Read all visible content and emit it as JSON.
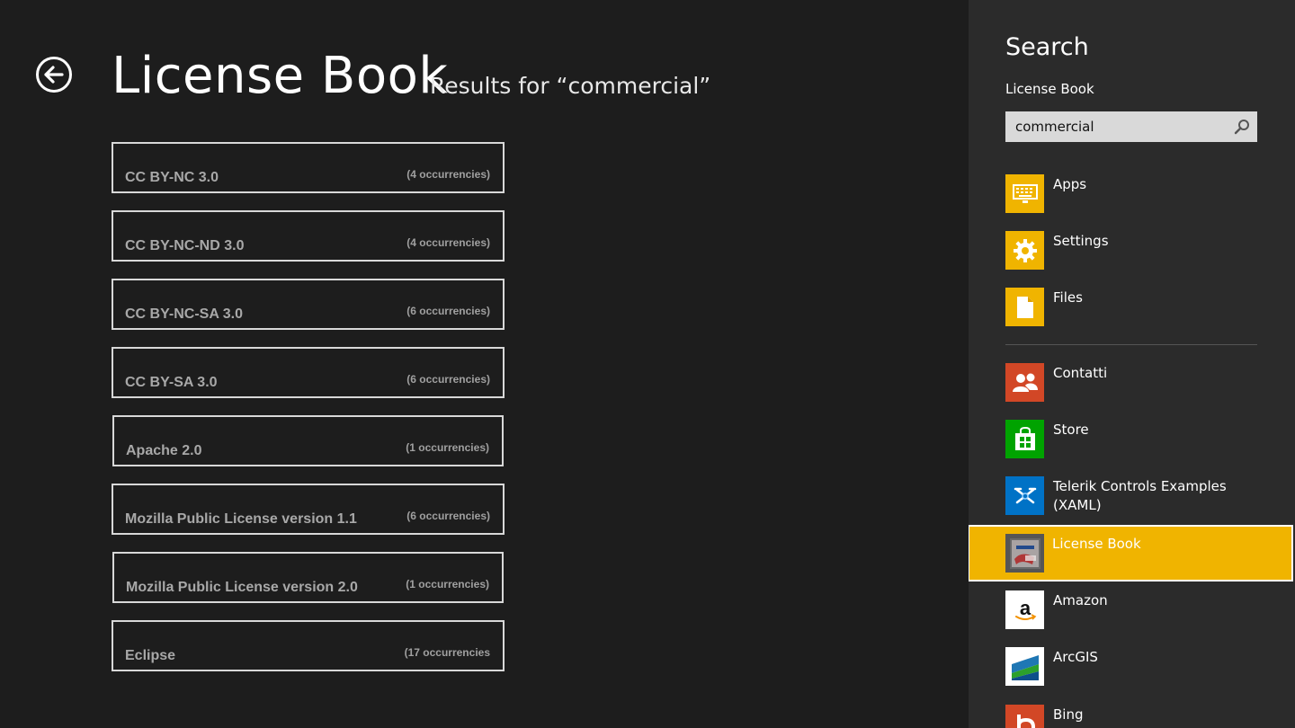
{
  "header": {
    "title": "License Book",
    "results_heading": "Results for “commercial”",
    "back_icon": "back-arrow-icon"
  },
  "results": [
    {
      "name": "CC BY-NC 3.0",
      "count": "(4 occurrencies)"
    },
    {
      "name": "CC BY-NC-ND 3.0",
      "count": "(4 occurrencies)"
    },
    {
      "name": "CC BY-NC-SA 3.0",
      "count": "(6 occurrencies)"
    },
    {
      "name": "CC BY-SA 3.0",
      "count": "(6 occurrencies)"
    },
    {
      "name": "Apache 2.0",
      "count": "(1 occurrencies)"
    },
    {
      "name": "Mozilla Public License version 1.1",
      "count": "(6 occurrencies)"
    },
    {
      "name": "Mozilla Public License version 2.0",
      "count": "(1 occurrencies)"
    },
    {
      "name": "Eclipse",
      "count": "(17 occurrencies"
    }
  ],
  "search_charm": {
    "title": "Search",
    "scope": "License Book",
    "query": "commercial",
    "categories": [
      {
        "label": "Apps",
        "icon": "keyboard-icon",
        "color": "#f0b400"
      },
      {
        "label": "Settings",
        "icon": "gear-icon",
        "color": "#f0b400"
      },
      {
        "label": "Files",
        "icon": "file-icon",
        "color": "#f0b400"
      }
    ],
    "apps": [
      {
        "label": "Contatti",
        "icon": "people-icon",
        "color": "#d24726"
      },
      {
        "label": "Store",
        "icon": "store-bag-icon",
        "color": "#00a300"
      },
      {
        "label": "Telerik Controls Examples (XAML)",
        "icon": "telerik-icon",
        "color": "#0072c6"
      },
      {
        "label": "License Book",
        "icon": "license-book-icon",
        "color": "#555555",
        "selected": true
      },
      {
        "label": "Amazon",
        "icon": "amazon-icon",
        "color": "#ffffff"
      },
      {
        "label": "ArcGIS",
        "icon": "arcgis-icon",
        "color": "#ffffff"
      },
      {
        "label": "Bing",
        "icon": "bing-icon",
        "color": "#d24726"
      }
    ]
  }
}
